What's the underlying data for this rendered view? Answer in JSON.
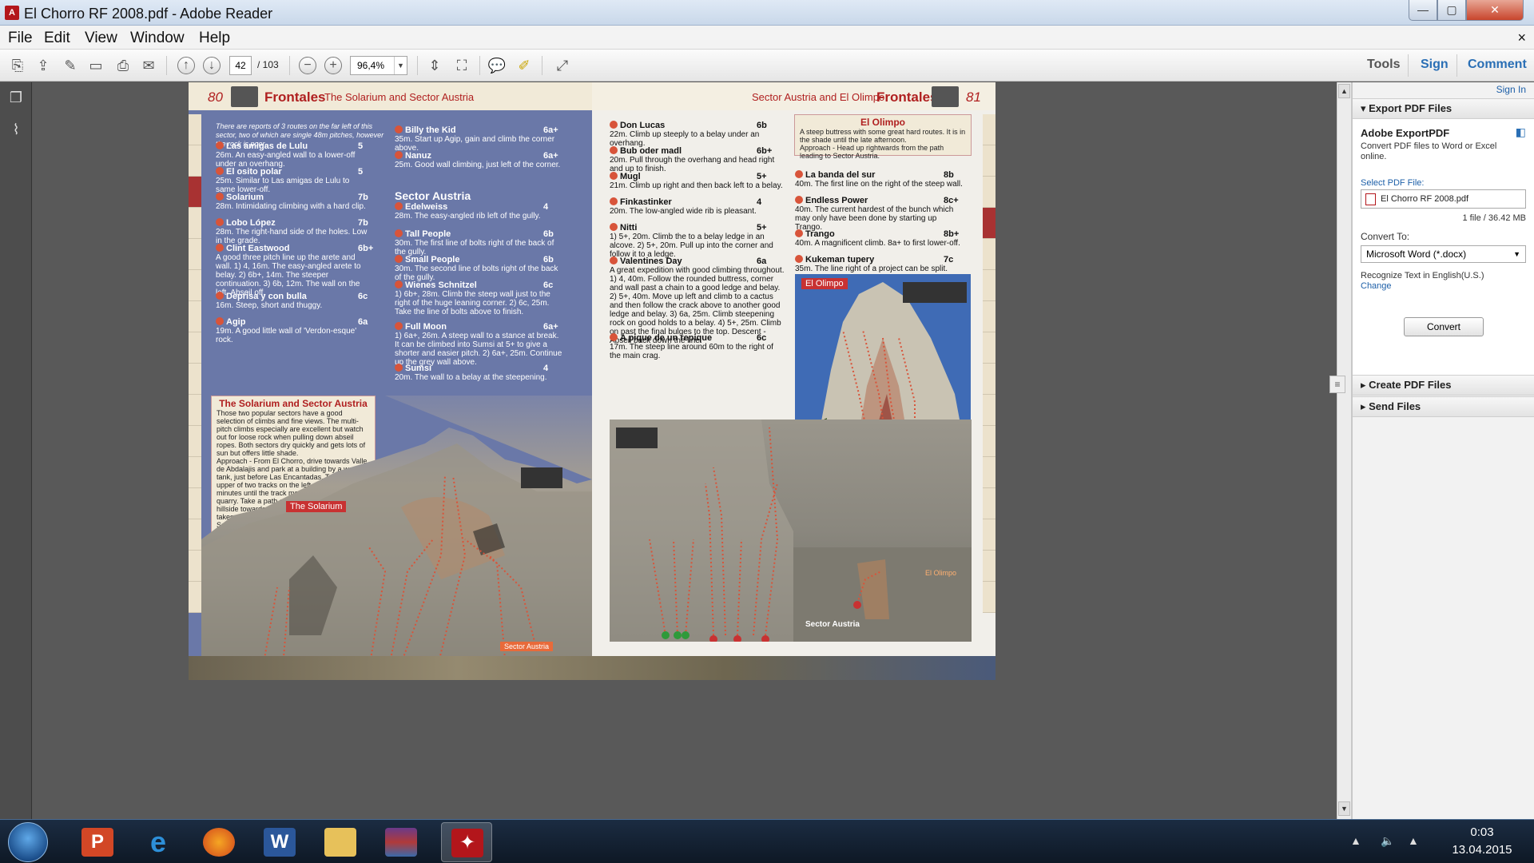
{
  "window": {
    "title": "El Chorro RF 2008.pdf - Adobe Reader",
    "icon": "adobe-reader-icon"
  },
  "menu": [
    "File",
    "Edit",
    "View",
    "Window",
    "Help"
  ],
  "toolbar": {
    "page_current": "42",
    "page_total": "/ 103",
    "zoom": "96,4%",
    "tabs": [
      "Tools",
      "Sign",
      "Comment"
    ]
  },
  "right_pane": {
    "sign_in": "Sign In",
    "export_title": "Export PDF Files",
    "exportpdf_heading": "Adobe ExportPDF",
    "exportpdf_desc": "Convert PDF files to Word or Excel online.",
    "select_label": "Select PDF File:",
    "selected_file": "El Chorro RF 2008.pdf",
    "file_meta": "1 file / 36.42 MB",
    "convert_to_label": "Convert To:",
    "convert_to_value": "Microsoft Word (*.docx)",
    "recognize_text": "Recognize Text in English(U.S.)",
    "change_link": "Change",
    "convert_button": "Convert",
    "create_title": "Create PDF Files",
    "send_title": "Send Files"
  },
  "pdf_left": {
    "page_number": "80",
    "section": "Frontales",
    "subtitle": "The Solarium and Sector Austria",
    "intro": "There are reports of 3 routes on the far left of this sector, two of which are single 48m pitches, however the rock is poor.",
    "routes_col1": [
      {
        "n": "1",
        "name": "Las amigas de Lulu",
        "grade": "5",
        "desc": "26m. An easy-angled wall to a lower-off under an overhang."
      },
      {
        "n": "2",
        "name": "El osito polar",
        "grade": "5",
        "desc": "25m. Similar to Las amigas de Lulu to same lower-off."
      },
      {
        "n": "3",
        "name": "Solarium",
        "grade": "7b",
        "desc": "28m. Intimidating climbing with a hard clip."
      },
      {
        "n": "4",
        "name": "Lobo López",
        "grade": "7b",
        "desc": "28m. The right-hand side of the holes. Low in the grade."
      },
      {
        "n": "5",
        "name": "Clint Eastwood",
        "grade": "6b+",
        "desc": "A good three pitch line up the arete and wall. 1) 4, 16m. The easy-angled arete to belay. 2) 6b+, 14m. The steeper continuation. 3) 6b, 12m. The wall on the left. Abseil off."
      },
      {
        "n": "6",
        "name": "Deprisa y con bulla",
        "grade": "6c",
        "desc": "16m. Steep, short and thuggy."
      },
      {
        "n": "7",
        "name": "Agip",
        "grade": "6a",
        "desc": "19m. A good little wall of 'Verdon-esque' rock."
      }
    ],
    "routes_col2": [
      {
        "n": "8",
        "name": "Billy the Kid",
        "grade": "6a+",
        "desc": "35m. Start up Agip, gain and climb the corner above."
      },
      {
        "n": "9",
        "name": "Nanuz",
        "grade": "6a+",
        "desc": "25m. Good wall climbing, just left of the corner."
      }
    ],
    "sector_austria": "Sector Austria",
    "routes_col3": [
      {
        "n": "10",
        "name": "Edelweiss",
        "grade": "4",
        "desc": "28m. The easy-angled rib left of the gully."
      },
      {
        "n": "11",
        "name": "Tall People",
        "grade": "6b",
        "desc": "30m. The first line of bolts right of the back of the gully."
      },
      {
        "n": "12",
        "name": "Small People",
        "grade": "6b",
        "desc": "30m. The second line of bolts right of the back of the gully."
      },
      {
        "n": "13",
        "name": "Wienes Schnitzel",
        "grade": "6c",
        "desc": "1) 6b+, 28m. Climb the steep wall just to the right of the huge leaning corner. 2) 6c, 25m. Take the line of bolts above to finish."
      },
      {
        "n": "14",
        "name": "Full Moon",
        "grade": "6a+",
        "desc": "1) 6a+, 26m. A steep wall to a stance at break. It can be climbed into Sumsi at 5+ to give a shorter and easier pitch. 2) 6a+, 25m. Continue up the grey wall above."
      },
      {
        "n": "15",
        "name": "Sumsi",
        "grade": "4",
        "desc": "20m. The wall to a belay at the steepening."
      }
    ],
    "infobox_title": "The Solarium and Sector Austria",
    "infobox_text": "Those two popular sectors have a good selection of climbs and fine views. The multi-pitch climbs especially are excellent but watch out for loose rock when pulling down abseil ropes. Both sectors dry quickly and gets lots of sun but offers little shade.",
    "infobox_approach": "Approach - From El Chorro, drive towards Valle de Abdalajis and park at a building by a water tank, just before Las Encantadas. Take the upper of two tracks on the left and walk for 10 minutes until the track meets the hillside at a quarry. Take a path on the left and traverse the hillside towards the Poema Cave. This path takes you under Sector Austria and on to The Solarium.",
    "photo_label_solarium": "The Solarium",
    "photo_label_austria": "Sector Austria"
  },
  "pdf_right": {
    "page_number": "81",
    "section": "Frontales",
    "subtitle": "Sector Austria and El Olimpo",
    "routes_col1": [
      {
        "n": "16",
        "name": "Don Lucas",
        "grade": "6b",
        "desc": "22m. Climb up steeply to a belay under an overhang."
      },
      {
        "n": "17",
        "name": "Bub oder madl",
        "grade": "6b+",
        "desc": "20m. Pull through the overhang and head right and up to finish."
      },
      {
        "n": "18",
        "name": "Mugl",
        "grade": "5+",
        "desc": "21m. Climb up right and then back left to a belay."
      },
      {
        "n": "19",
        "name": "Finkastinker",
        "grade": "4",
        "desc": "20m. The low-angled wide rib is pleasant."
      },
      {
        "n": "20",
        "name": "Nitti",
        "grade": "5+",
        "desc": "1) 5+, 20m. Climb the to a belay ledge in an alcove. 2) 5+, 20m. Pull up into the corner and follow it to a ledge."
      },
      {
        "n": "21",
        "name": "Valentines Day",
        "grade": "6a",
        "desc": "A great expedition with good climbing throughout. 1) 4, 40m. Follow the rounded buttress, corner and wall past a chain to a good ledge and belay. 2) 5+, 40m. Move up left and climb to a cactus and then follow the crack above to another good ledge and belay. 3) 6a, 25m. Climb steepening rock on good holds to a belay. 4) 5+, 25m. Climb on past the final bulges to the top. Descent - Abseil back down the line."
      },
      {
        "n": "22",
        "name": "A pique de un repique",
        "grade": "6c",
        "desc": "17m. The steep line around 60m to the right of the main crag."
      }
    ],
    "olimpo_title": "El Olimpo",
    "olimpo_text": "A steep buttress with some great hard routes. It is in the shade until the late afternoon.",
    "olimpo_approach": "Approach - Head up rightwards from the path leading to Sector Austria.",
    "routes_col2": [
      {
        "n": "23",
        "name": "La banda del sur",
        "grade": "8b",
        "desc": "40m. The first line on the right of the steep wall."
      },
      {
        "n": "24",
        "name": "Endless Power",
        "grade": "8c+",
        "desc": "40m. The current hardest of the bunch which may only have been done by starting up Trango."
      },
      {
        "n": "25",
        "name": "Trango",
        "grade": "8b+",
        "desc": "40m. A magnificent climb. 8a+ to first lower-off."
      },
      {
        "n": "26",
        "name": "Kukeman tupery",
        "grade": "7c",
        "desc": "35m. The line right of a project can be split."
      }
    ],
    "photo_label_olimpo": "El Olimpo",
    "photo_label_olimpo_small": "El Olimpo",
    "photo_label_austria": "Sector Austria"
  },
  "taskbar": {
    "time": "0:03",
    "date": "13.04.2015",
    "apps": [
      "start-button",
      "powerpoint",
      "internet-explorer",
      "firefox",
      "word",
      "file-explorer",
      "winrar",
      "adobe-reader"
    ]
  }
}
